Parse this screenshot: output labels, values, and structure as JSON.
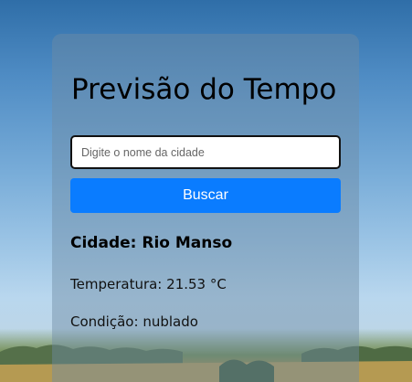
{
  "app": {
    "title": "Previsão do Tempo"
  },
  "search": {
    "placeholder": "Digite o nome da cidade",
    "value": "",
    "button_label": "Buscar"
  },
  "result": {
    "city_label": "Cidade:",
    "city": "Rio Manso",
    "temperature_label": "Temperatura:",
    "temperature": "21.53",
    "temperature_unit": "°C",
    "condition_label": "Condição:",
    "condition": "nublado"
  },
  "colors": {
    "button": "#0a7cff",
    "card": "rgba(110,140,165,0.45)"
  }
}
